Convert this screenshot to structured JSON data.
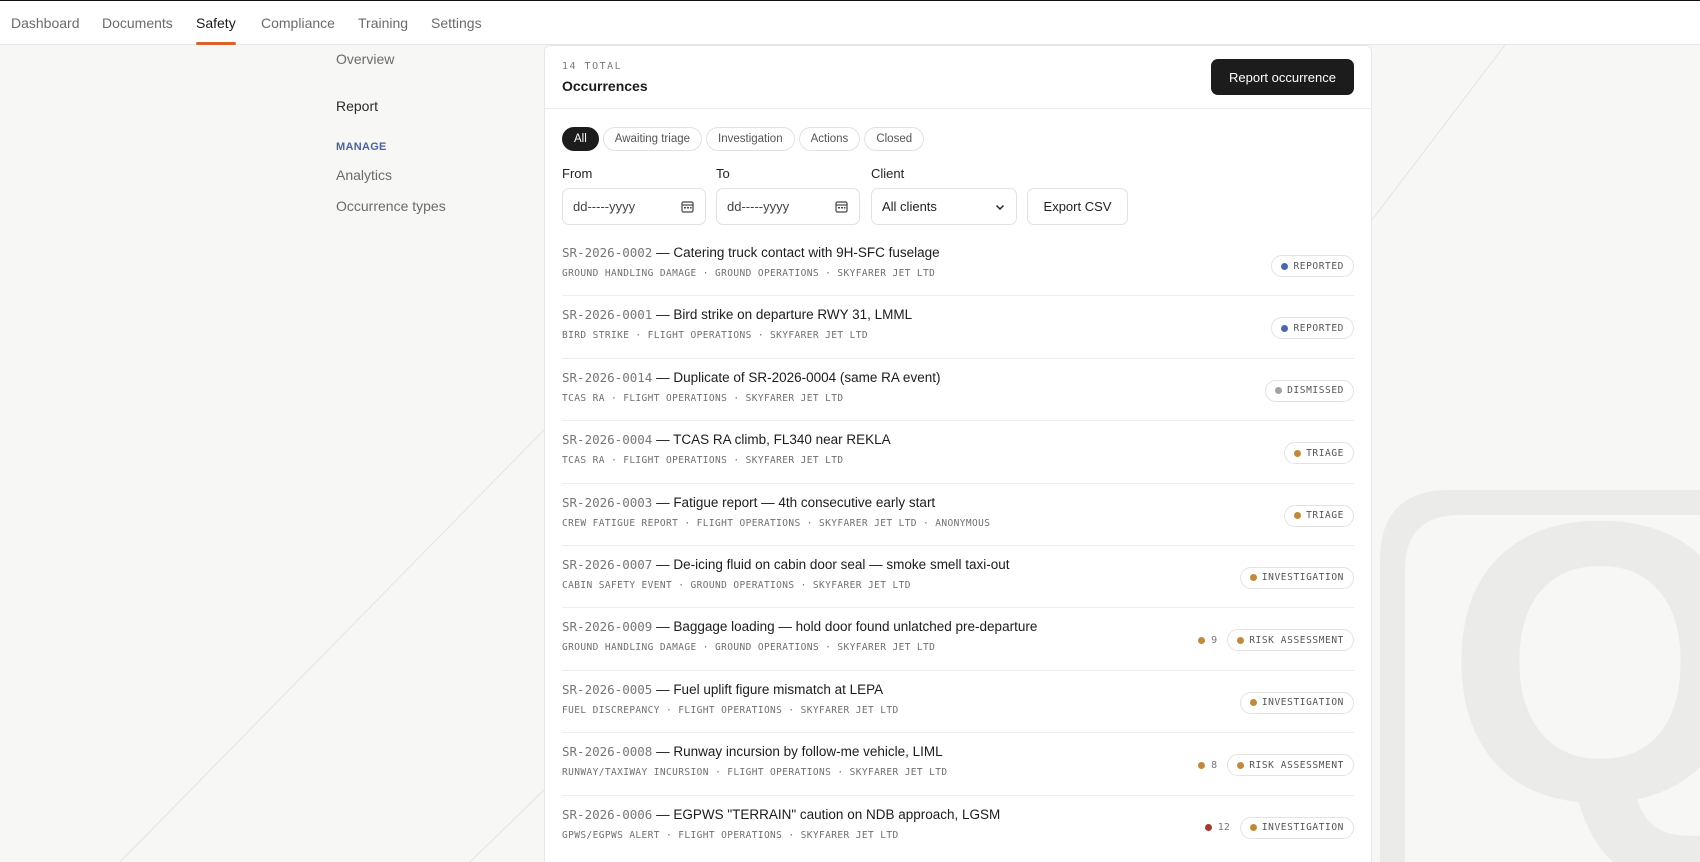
{
  "nav": {
    "items": [
      {
        "label": "Dashboard"
      },
      {
        "label": "Documents"
      },
      {
        "label": "Safety"
      },
      {
        "label": "Compliance"
      },
      {
        "label": "Training"
      },
      {
        "label": "Settings"
      }
    ],
    "active": "Safety",
    "accent": "#d9632b"
  },
  "sidebar": {
    "overview": "Overview",
    "report": "Report",
    "manage_heading": "MANAGE",
    "analytics": "Analytics",
    "occurrence_types": "Occurrence types"
  },
  "header": {
    "total": "14 TOTAL",
    "title": "Occurrences",
    "report_button": "Report occurrence"
  },
  "tabs": [
    {
      "label": "All"
    },
    {
      "label": "Awaiting triage"
    },
    {
      "label": "Investigation"
    },
    {
      "label": "Actions"
    },
    {
      "label": "Closed"
    }
  ],
  "active_tab": "All",
  "filters": {
    "from_label": "From",
    "from_placeholder": "dd-----yyyy",
    "to_label": "To",
    "to_placeholder": "dd-----yyyy",
    "client_label": "Client",
    "client_value": "All clients",
    "export_label": "Export CSV"
  },
  "status_colors": {
    "reported": "#4a68a8",
    "dismissed": "#a3a3a3",
    "triage": "#c08a3e",
    "investigation": "#c08a3e",
    "risk": "#c08a3e",
    "count_amber": "#c08a3e",
    "count_red": "#a8382f"
  },
  "occurrences": [
    {
      "id": "SR-2026-0002",
      "title": " — Catering truck contact with 9H-SFC fuselage",
      "meta": "GROUND HANDLING DAMAGE · GROUND OPERATIONS · SKYFARER JET LTD",
      "status": "REPORTED",
      "status_key": "reported",
      "count": null
    },
    {
      "id": "SR-2026-0001",
      "title": " — Bird strike on departure RWY 31, LMML",
      "meta": "BIRD STRIKE · FLIGHT OPERATIONS · SKYFARER JET LTD",
      "status": "REPORTED",
      "status_key": "reported",
      "count": null
    },
    {
      "id": "SR-2026-0014",
      "title": " — Duplicate of SR-2026-0004 (same RA event)",
      "meta": "TCAS RA · FLIGHT OPERATIONS · SKYFARER JET LTD",
      "status": "DISMISSED",
      "status_key": "dismissed",
      "count": null
    },
    {
      "id": "SR-2026-0004",
      "title": " — TCAS RA climb, FL340 near REKLA",
      "meta": "TCAS RA · FLIGHT OPERATIONS · SKYFARER JET LTD",
      "status": "TRIAGE",
      "status_key": "triage",
      "count": null
    },
    {
      "id": "SR-2026-0003",
      "title": " — Fatigue report — 4th consecutive early start",
      "meta": "CREW FATIGUE REPORT · FLIGHT OPERATIONS · SKYFARER JET LTD · ANONYMOUS",
      "status": "TRIAGE",
      "status_key": "triage",
      "count": null
    },
    {
      "id": "SR-2026-0007",
      "title": " — De-icing fluid on cabin door seal — smoke smell taxi-out",
      "meta": "CABIN SAFETY EVENT · GROUND OPERATIONS · SKYFARER JET LTD",
      "status": "INVESTIGATION",
      "status_key": "investigation",
      "count": null
    },
    {
      "id": "SR-2026-0009",
      "title": " — Baggage loading — hold door found unlatched pre-departure",
      "meta": "GROUND HANDLING DAMAGE · GROUND OPERATIONS · SKYFARER JET LTD",
      "status": "RISK ASSESSMENT",
      "status_key": "risk",
      "count": "9",
      "count_key": "count_amber"
    },
    {
      "id": "SR-2026-0005",
      "title": " — Fuel uplift figure mismatch at LEPA",
      "meta": "FUEL DISCREPANCY · FLIGHT OPERATIONS · SKYFARER JET LTD",
      "status": "INVESTIGATION",
      "status_key": "investigation",
      "count": null
    },
    {
      "id": "SR-2026-0008",
      "title": " — Runway incursion by follow-me vehicle, LIML",
      "meta": "RUNWAY/TAXIWAY INCURSION · FLIGHT OPERATIONS · SKYFARER JET LTD",
      "status": "RISK ASSESSMENT",
      "status_key": "risk",
      "count": "8",
      "count_key": "count_amber"
    },
    {
      "id": "SR-2026-0006",
      "title": " — EGPWS \"TERRAIN\" caution on NDB approach, LGSM",
      "meta": "GPWS/EGPWS ALERT · FLIGHT OPERATIONS · SKYFARER JET LTD",
      "status": "INVESTIGATION",
      "status_key": "investigation",
      "count": "12",
      "count_key": "count_red"
    }
  ]
}
